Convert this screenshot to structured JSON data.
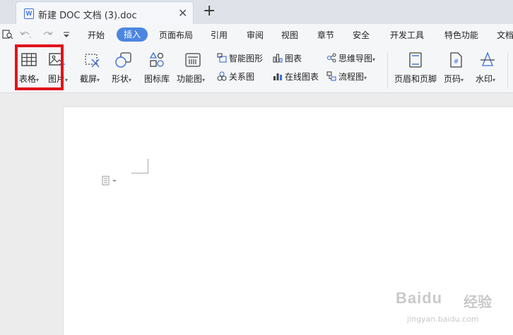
{
  "tab": {
    "title": "新建 DOC 文档 (3).doc",
    "close": "✕",
    "new": "+"
  },
  "menu": {
    "items": [
      "开始",
      "插入",
      "页面布局",
      "引用",
      "审阅",
      "视图",
      "章节",
      "安全",
      "开发工具",
      "特色功能",
      "文档"
    ],
    "active": "插入",
    "quick_icons": [
      "search-doc-icon",
      "undo-icon",
      "redo-icon",
      "quick-menu-icon"
    ]
  },
  "ribbon": {
    "table": "表格",
    "picture": "图片",
    "screenshot": "截屏",
    "shapes": "形状",
    "icon_library": "图标库",
    "function_chart": "功能图",
    "smart_graphic": "智能图形",
    "chart": "图表",
    "mind_map": "思维导图",
    "relation_chart": "关系图",
    "online_chart": "在线图表",
    "flowchart": "流程图",
    "header_footer": "页眉和页脚",
    "page_number": "页码",
    "watermark": "水印",
    "dropdown_glyph": "▾"
  },
  "watermark": {
    "brand": "Baidu",
    "brand_cn": "经验",
    "url": "jingyan.baidu.com"
  },
  "colors": {
    "accent": "#4d86e0",
    "highlight": "#e0141b",
    "icon_blue": "#3a6fd8"
  }
}
